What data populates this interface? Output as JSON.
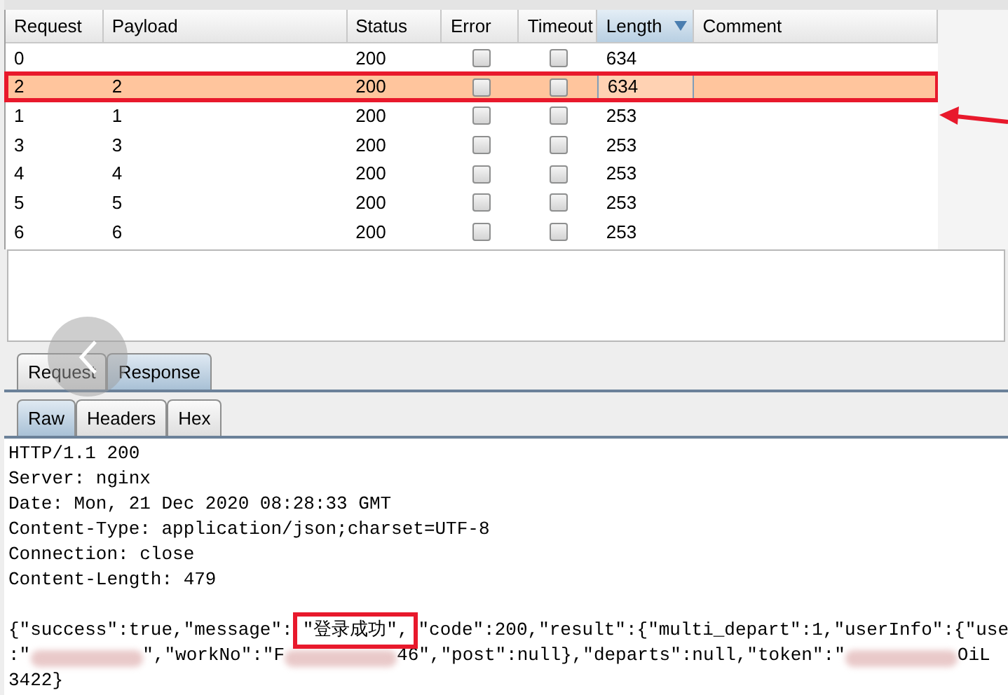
{
  "table": {
    "columns": [
      {
        "label": "Request",
        "sorted": false
      },
      {
        "label": "Payload",
        "sorted": false
      },
      {
        "label": "Status",
        "sorted": false
      },
      {
        "label": "Error",
        "sorted": false
      },
      {
        "label": "Timeout",
        "sorted": false
      },
      {
        "label": "Length",
        "sorted": true
      },
      {
        "label": "Comment",
        "sorted": false
      }
    ],
    "rows": [
      {
        "request": "0",
        "payload": "",
        "status": "200",
        "error": false,
        "timeout": false,
        "length": "634",
        "selected": false
      },
      {
        "request": "2",
        "payload": "2",
        "status": "200",
        "error": false,
        "timeout": false,
        "length": "634",
        "selected": true,
        "annotated": true
      },
      {
        "request": "1",
        "payload": "1",
        "status": "200",
        "error": false,
        "timeout": false,
        "length": "253",
        "selected": false
      },
      {
        "request": "3",
        "payload": "3",
        "status": "200",
        "error": false,
        "timeout": false,
        "length": "253",
        "selected": false
      },
      {
        "request": "4",
        "payload": "4",
        "status": "200",
        "error": false,
        "timeout": false,
        "length": "253",
        "selected": false
      },
      {
        "request": "5",
        "payload": "5",
        "status": "200",
        "error": false,
        "timeout": false,
        "length": "253",
        "selected": false
      },
      {
        "request": "6",
        "payload": "6",
        "status": "200",
        "error": false,
        "timeout": false,
        "length": "253",
        "selected": false
      }
    ]
  },
  "message_tabs": [
    {
      "label": "Request",
      "selected": false
    },
    {
      "label": "Response",
      "selected": true
    }
  ],
  "view_tabs": [
    {
      "label": "Raw",
      "selected": true
    },
    {
      "label": "Headers",
      "selected": false
    },
    {
      "label": "Hex",
      "selected": false
    }
  ],
  "response_headers": [
    {
      "parts": [
        {
          "kind": "text",
          "text": "HTTP/1.1 200"
        }
      ]
    },
    {
      "parts": [
        {
          "kind": "text",
          "text": "Server: nginx"
        }
      ]
    },
    {
      "parts": [
        {
          "kind": "text",
          "text": "Date: Mon, 21 Dec 2020 08:28:33 GMT"
        }
      ]
    },
    {
      "parts": [
        {
          "kind": "text",
          "text": "Content-Type: application/json;charset=UTF-8"
        }
      ]
    },
    {
      "parts": [
        {
          "kind": "text",
          "text": "Connection: close"
        }
      ]
    },
    {
      "parts": [
        {
          "kind": "text",
          "text": "Content-Length: 479"
        }
      ]
    }
  ],
  "response_body": [
    {
      "parts": [
        {
          "kind": "text",
          "text": "{\"success\":true,\"message\":"
        },
        {
          "kind": "boxed",
          "text": "\"登录成功\","
        },
        {
          "kind": "text",
          "text": "\"code\":200,\"result\":{\"multi_depart\":1,\"userInfo\":{\"use"
        }
      ]
    },
    {
      "parts": [
        {
          "kind": "text",
          "text": ":\""
        },
        {
          "kind": "redacted"
        },
        {
          "kind": "text",
          "text": "\",\"workNo\":\"F"
        },
        {
          "kind": "redacted"
        },
        {
          "kind": "text",
          "text": "46\",\"post\":null},\"departs\":null,\"token\":\""
        },
        {
          "kind": "redacted"
        },
        {
          "kind": "text",
          "text": "OiL"
        }
      ]
    },
    {
      "parts": [
        {
          "kind": "text",
          "text": "3422}"
        }
      ]
    }
  ]
}
